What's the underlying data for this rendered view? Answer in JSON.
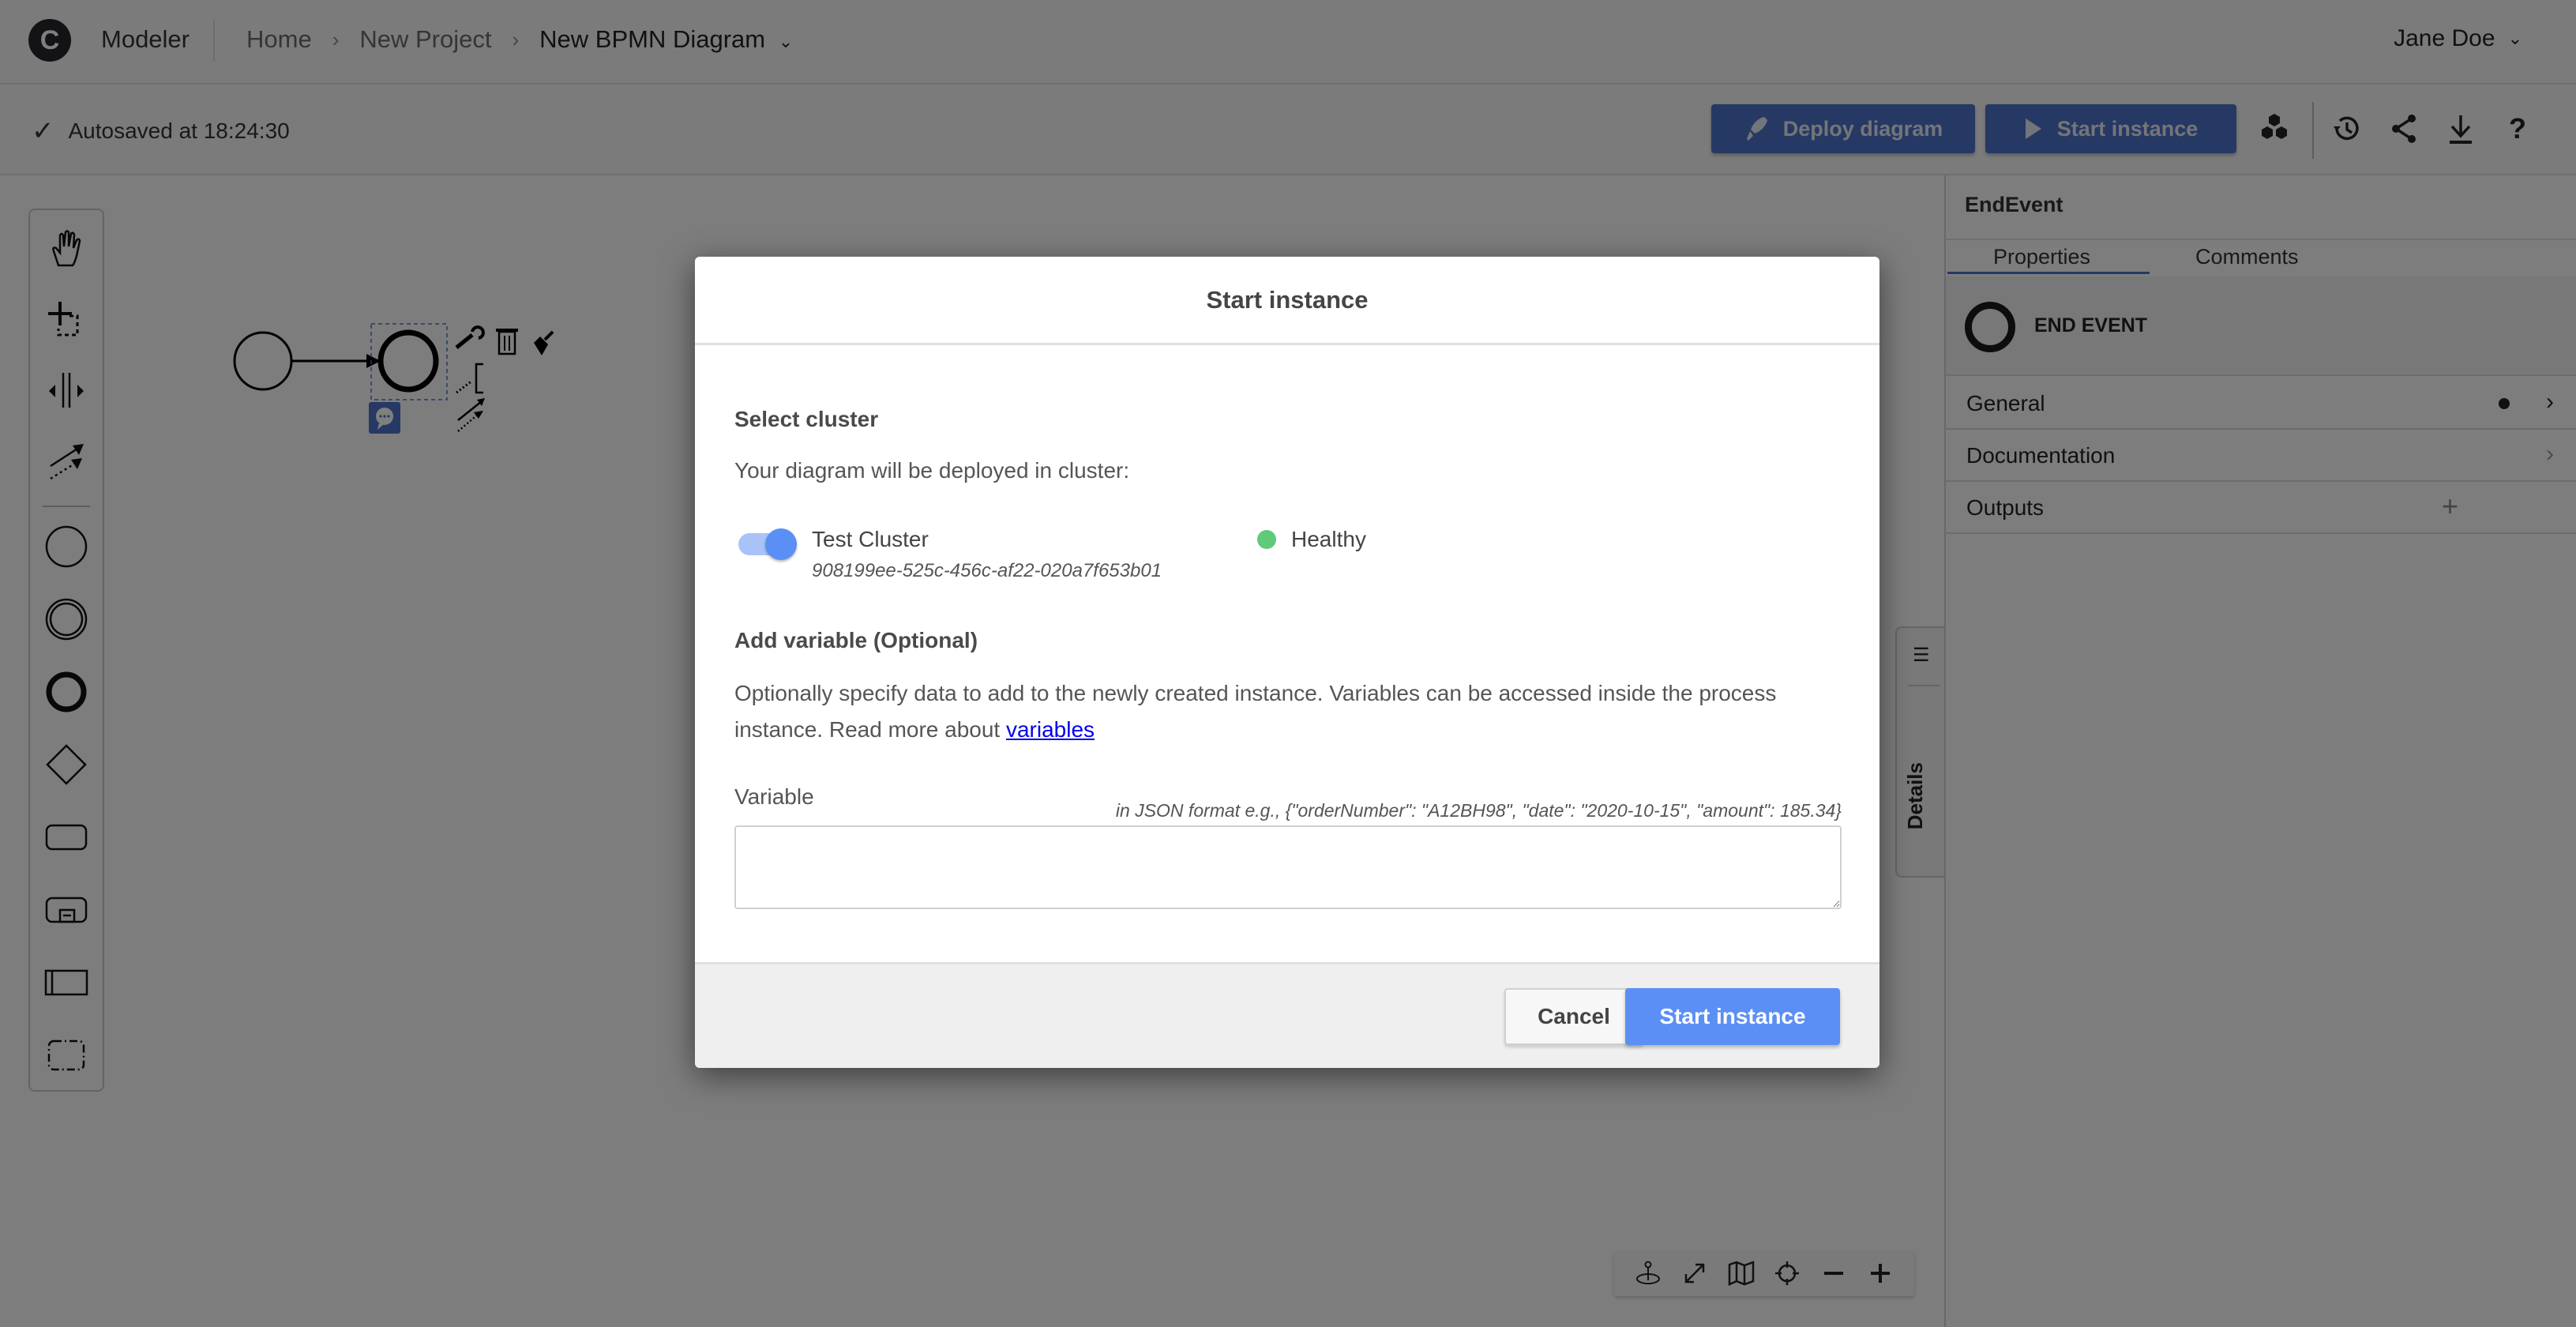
{
  "header": {
    "logo_letter": "C",
    "app_name": "Modeler",
    "breadcrumb": [
      {
        "label": "Home"
      },
      {
        "label": "New Project"
      },
      {
        "label": "New BPMN Diagram"
      }
    ],
    "breadcrumb_separator": "›",
    "user_name": "Jane Doe"
  },
  "toolbar": {
    "autosave_text": "Autosaved at 18:24:30",
    "deploy_label": "Deploy diagram",
    "start_label": "Start instance",
    "icons": [
      "cluster-icon",
      "history-icon",
      "share-icon",
      "download-icon",
      "help-icon"
    ]
  },
  "palette": {
    "tools": [
      "hand-tool",
      "lasso-tool",
      "space-tool",
      "global-connect-tool"
    ],
    "elements": [
      "start-event",
      "intermediate-event",
      "end-event",
      "gateway",
      "task",
      "subprocess",
      "pool",
      "group"
    ]
  },
  "canvas": {
    "elements": [
      {
        "type": "start-event"
      },
      {
        "type": "sequence-flow"
      },
      {
        "type": "end-event",
        "selected": true
      }
    ],
    "context_pad": [
      "wrench-icon",
      "trash-icon",
      "paintbrush-icon",
      "text-annotation-icon",
      "connect-icon",
      "comment-icon"
    ],
    "details_tab_label": "Details",
    "zoom_controls": [
      "reset-position-icon",
      "fullscreen-icon",
      "minimap-icon",
      "center-icon",
      "zoom-out-icon",
      "zoom-in-icon"
    ]
  },
  "properties": {
    "element_title": "EndEvent",
    "tabs": [
      {
        "label": "Properties",
        "active": true
      },
      {
        "label": "Comments",
        "active": false
      }
    ],
    "element_type_label": "END EVENT",
    "groups": [
      {
        "name": "General",
        "has_indicator": true,
        "action": "chevron"
      },
      {
        "name": "Documentation",
        "has_indicator": false,
        "action": "chevron"
      },
      {
        "name": "Outputs",
        "has_indicator": false,
        "action": "add"
      }
    ]
  },
  "modal": {
    "title": "Start instance",
    "cluster_section_title": "Select cluster",
    "cluster_description": "Your diagram will be deployed in cluster:",
    "cluster": {
      "name": "Test Cluster",
      "id": "908199ee-525c-456c-af22-020a7f653b01",
      "selected": true,
      "status": "Healthy",
      "status_color": "#61c97a"
    },
    "variable_section_title": "Add variable (Optional)",
    "variable_description": "Optionally specify data to add to the newly created instance. Variables can be accessed inside the process instance. Read more about ",
    "variable_link_text": "variables",
    "variable_label": "Variable",
    "variable_hint": "in JSON format e.g., {\"orderNumber\": \"A12BH98\", \"date\": \"2020-10-15\", \"amount\": 185.34}",
    "variable_value": "",
    "cancel_label": "Cancel",
    "submit_label": "Start instance"
  },
  "colors": {
    "primary": "#4d73c8",
    "primary_active": "#5b8ff5",
    "healthy": "#61c97a"
  }
}
